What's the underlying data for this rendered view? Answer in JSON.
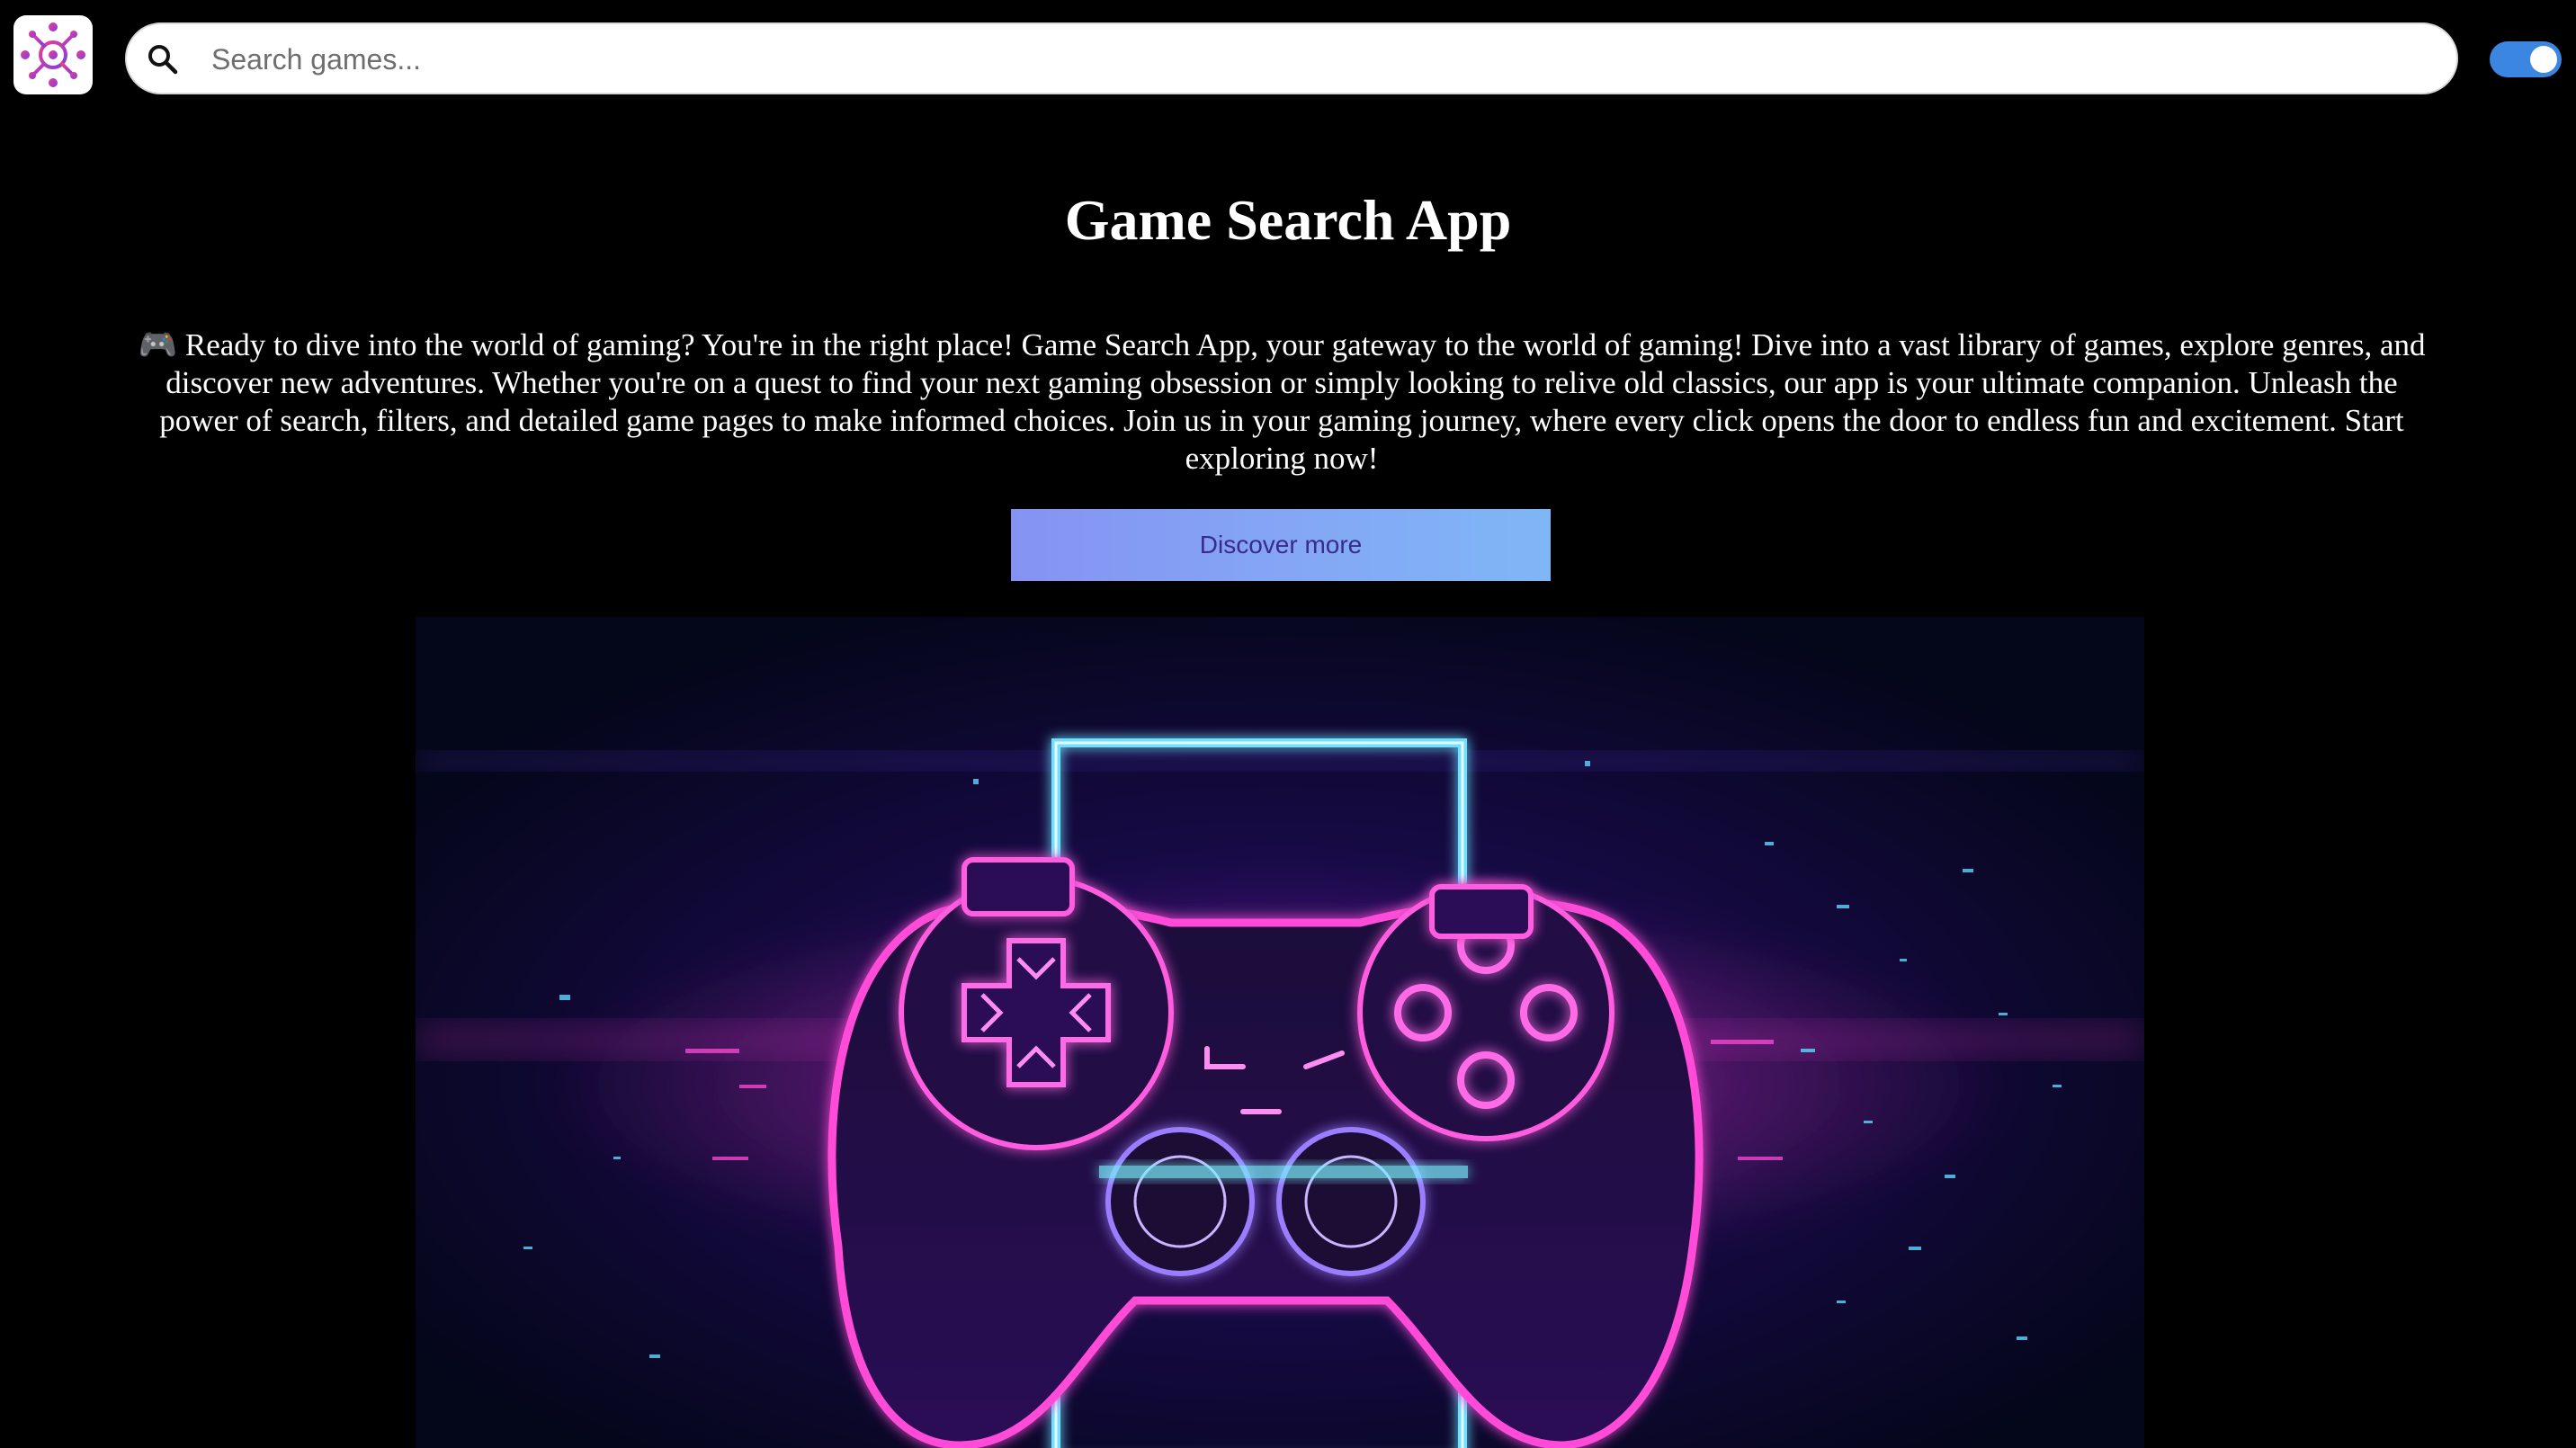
{
  "header": {
    "logo_icon": "virus-molecule-logo-icon",
    "search": {
      "placeholder": "Search games...",
      "value": "",
      "icon": "search-icon"
    },
    "theme_toggle": {
      "state": "on",
      "color": "#3b86e0"
    }
  },
  "hero": {
    "title": "Game Search App",
    "intro": "🎮 Ready to dive into the world of gaming? You're in the right place! Game Search App, your gateway to the world of gaming! Dive into a vast library of games, explore genres, and discover new adventures. Whether you're on a quest to find your next gaming obsession or simply looking to relive old classics, our app is your ultimate companion. Unleash the power of search, filters, and detailed game pages to make informed choices. Join us in your gaming journey, where every click opens the door to endless fun and excitement. Start exploring now!",
    "cta_label": "Discover more",
    "image_subject": "neon-gamepad-controller-image"
  },
  "colors": {
    "background": "#000000",
    "text": "#ffffff",
    "cta_gradient_start": "#8592f2",
    "cta_gradient_end": "#7fb6f6",
    "cta_text": "#3a2a8c",
    "neon_pink": "#e040fb",
    "neon_blue": "#4fc3ff"
  }
}
